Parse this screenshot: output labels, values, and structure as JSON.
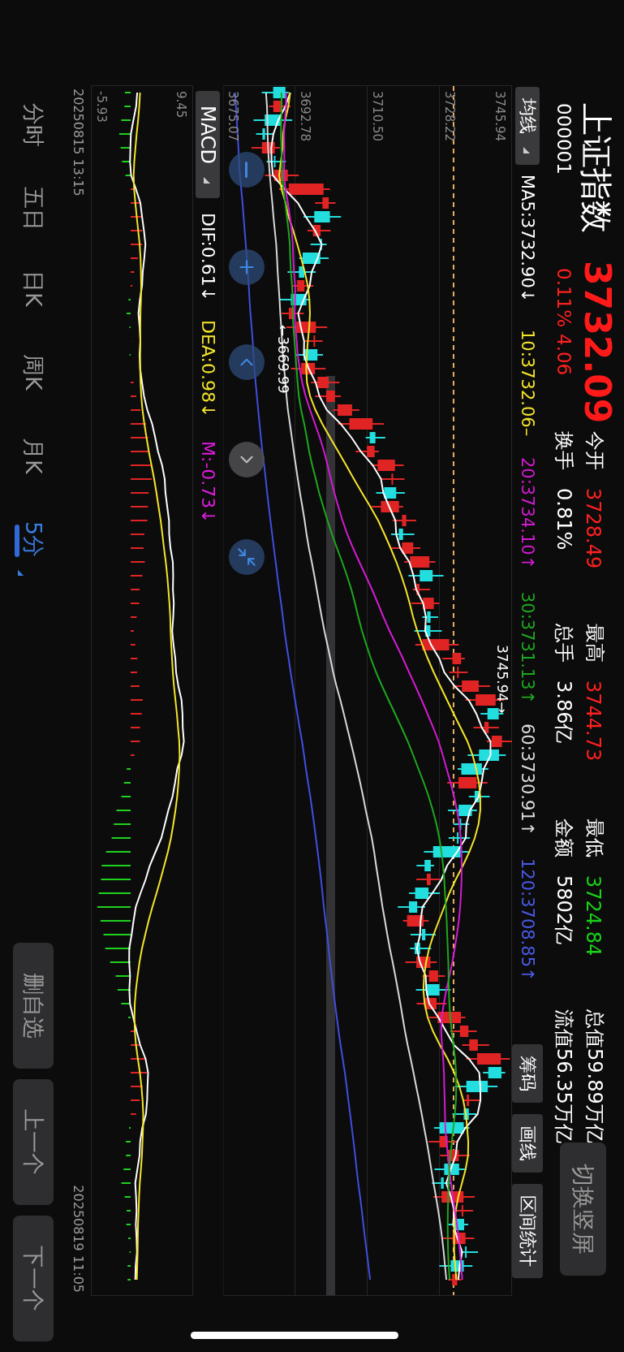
{
  "header": {
    "name": "上证指数",
    "price": "3732.09",
    "code": "000001",
    "change_pct": "0.11%",
    "change": "4.06",
    "stats": [
      {
        "label": "今开",
        "value": "3728.49",
        "color": "#ff2020"
      },
      {
        "label": "最高",
        "value": "3744.73",
        "color": "#ff2020"
      },
      {
        "label": "最低",
        "value": "3724.84",
        "color": "#19d219"
      },
      {
        "label": "总值",
        "value": "59.89万亿",
        "color": "#ffffff"
      },
      {
        "label": "换手",
        "value": "0.81%",
        "color": "#ffffff"
      },
      {
        "label": "总手",
        "value": "3.86亿",
        "color": "#ffffff"
      },
      {
        "label": "金额",
        "value": "5802亿",
        "color": "#ffffff"
      },
      {
        "label": "流值",
        "value": "56.35万亿",
        "color": "#ffffff"
      }
    ],
    "switch_button": "切换竖屏"
  },
  "ma_bar": {
    "selector": "均线",
    "values": [
      {
        "text": "MA5:3732.90↓",
        "color": "#ffffff"
      },
      {
        "text": "10:3732.06–",
        "color": "#f5e52a"
      },
      {
        "text": "20:3734.10↑",
        "color": "#d21bd2"
      },
      {
        "text": "30:3731.13↑",
        "color": "#1ea81e"
      },
      {
        "text": "60:3730.91↑",
        "color": "#dddddd"
      },
      {
        "text": "120:3708.85↑",
        "color": "#4a5ae8"
      }
    ],
    "tools": [
      "筹码",
      "画线",
      "区间统计"
    ]
  },
  "price_chart": {
    "y_labels": [
      "3745.94",
      "3728.22",
      "3710.50",
      "3692.78",
      "3675.07"
    ],
    "high_marker": "3745.94→",
    "low_marker": "←3669.99"
  },
  "macd_bar": {
    "selector": "MACD",
    "values": [
      {
        "text": "DIF:0.61↓",
        "color": "#ffffff"
      },
      {
        "text": "DEA:0.98↓",
        "color": "#f5e52a"
      },
      {
        "text": "M:-0.73↓",
        "color": "#e01be0"
      }
    ]
  },
  "macd_chart": {
    "y_labels": [
      "9.45",
      "-5.93"
    ]
  },
  "time_axis": [
    "20250815 13:15",
    "20250819 11:05"
  ],
  "periods": [
    {
      "label": "分时",
      "selected": false
    },
    {
      "label": "五日",
      "selected": false
    },
    {
      "label": "日K",
      "selected": false
    },
    {
      "label": "周K",
      "selected": false
    },
    {
      "label": "月K",
      "selected": false
    },
    {
      "label": "5分",
      "selected": true
    }
  ],
  "actions": [
    "删自选",
    "上一个",
    "下一个"
  ]
}
